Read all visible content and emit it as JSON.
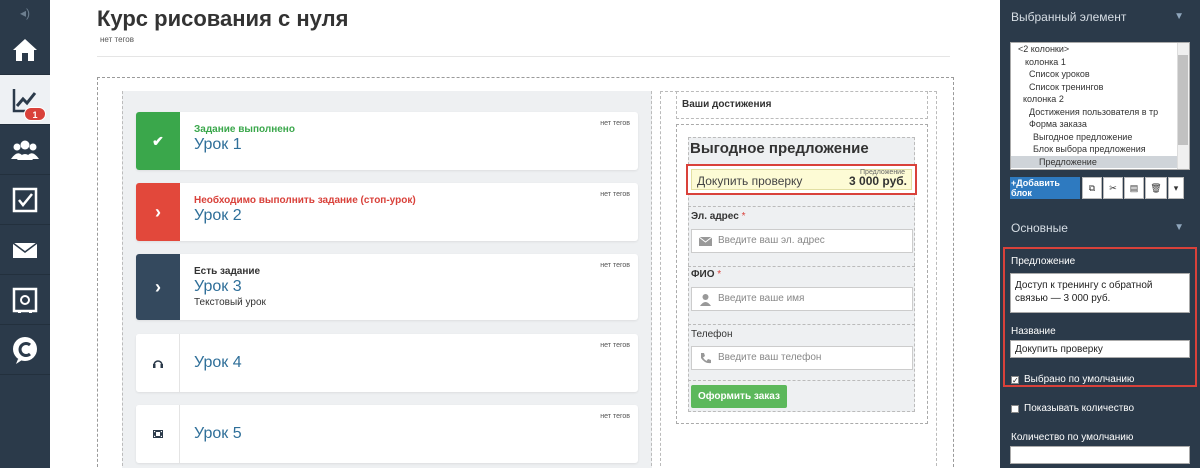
{
  "leftbar": {
    "items": [
      {
        "name": "home-icon"
      },
      {
        "name": "stats-icon",
        "badge": "1"
      },
      {
        "name": "users-icon"
      },
      {
        "name": "tasks-icon"
      },
      {
        "name": "mail-icon"
      },
      {
        "name": "safe-icon"
      },
      {
        "name": "c-logo-icon"
      }
    ]
  },
  "page": {
    "title": "Курс рисования с нуля",
    "tags": "нет тегов"
  },
  "lessons": [
    {
      "status": "Задание выполнено",
      "status_color": "#3aa74b",
      "title": "Урок 1",
      "tags": "нет тегов",
      "side_color": "#3aa74b",
      "icon": "✔"
    },
    {
      "status": "Необходимо выполнить задание (стоп-урок)",
      "status_color": "#d9413a",
      "title": "Урок 2",
      "tags": "нет тегов",
      "side_color": "#e2483b",
      "icon": "›"
    },
    {
      "status": "Есть задание",
      "status_color": "#333333",
      "title": "Урок 3",
      "subtitle": "Текстовый урок",
      "tags": "нет тегов",
      "side_color": "#34495e",
      "icon": "›"
    },
    {
      "title": "Урок 4",
      "tags": "нет тегов",
      "icon": "headphones-icon"
    },
    {
      "title": "Урок 5",
      "tags": "нет тегов",
      "icon": "film-icon"
    }
  ],
  "order_form": {
    "achievements": "Ваши достижения",
    "offer_block_title": "Выгодное предложение",
    "offer": {
      "label": "Докупить проверку",
      "price": "3 000 руб.",
      "caption": "Предложение"
    },
    "email": {
      "label": "Эл. адрес",
      "required": "*",
      "placeholder": "Введите ваш эл. адрес"
    },
    "name": {
      "label": "ФИО",
      "required": "*",
      "placeholder": "Введите ваше имя"
    },
    "phone": {
      "label": "Телефон",
      "placeholder": "Введите ваш телефон"
    },
    "submit": "Оформить заказ"
  },
  "right_panel": {
    "selected_title": "Выбранный элемент",
    "tree": [
      "<2 колонки>",
      "колонка 1",
      "Список уроков",
      "Список тренингов",
      "колонка 2",
      "Достижения пользователя в тр",
      "Форма заказа",
      "Выгодное предложение",
      "Блок выбора предложения",
      "Предложение"
    ],
    "add_block": "+Добавить блок",
    "section_main": "Основные",
    "offer_label": "Предложение",
    "offer_text": "Доступ к тренингу с обратной связью — 3 000 руб.",
    "name_label": "Название",
    "name_value": "Докупить проверку",
    "default_selected": "Выбрано по умолчанию",
    "show_quantity": "Показывать количество",
    "default_quantity_label": "Количество по умолчанию"
  }
}
